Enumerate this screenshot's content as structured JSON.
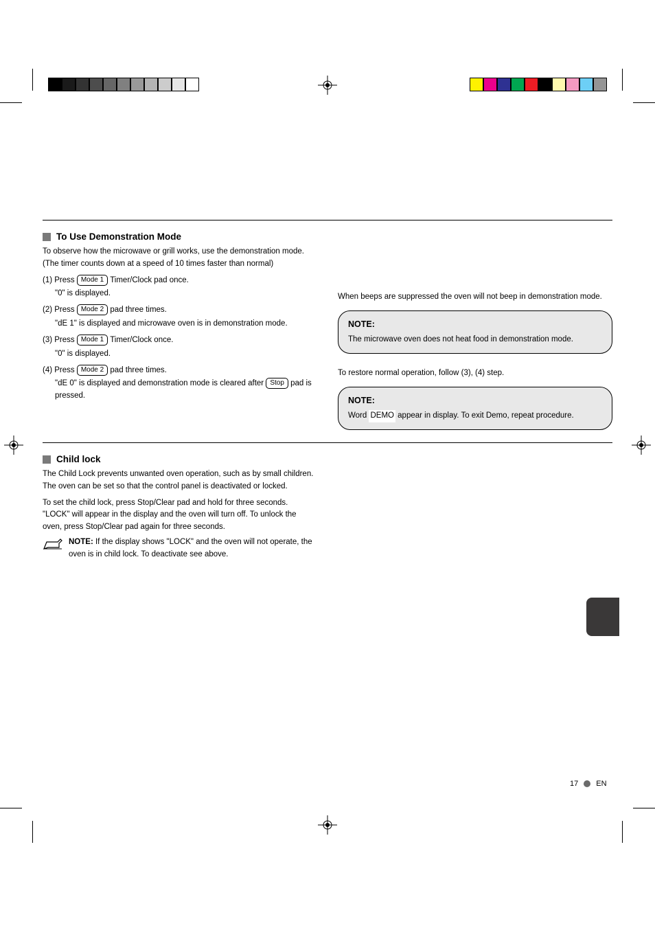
{
  "swatches": {
    "grays": [
      "#000000",
      "#1a1a1a",
      "#333333",
      "#4d4d4d",
      "#666666",
      "#808080",
      "#999999",
      "#b3b3b3",
      "#cccccc",
      "#e5e5e5",
      "#ffffff"
    ],
    "colors": [
      "#fff200",
      "#ec008c",
      "#2e3192",
      "#00a651",
      "#ed1c24",
      "#000000",
      "#fff9ae",
      "#f49ac1",
      "#6dcff6",
      "#959595"
    ]
  },
  "sections": {
    "demo": {
      "title": "To Use Demonstration Mode",
      "left": {
        "l1": "To observe how the microwave or grill works, use the demonstration mode. (The timer counts down at a speed of 10 times faster than normal)",
        "l2a": "(1)  Press ",
        "l2b": "Timer/Clock pad once.",
        "l3a": "\"0\" is displayed.",
        "l4a": "(2) Press ",
        "l4b": "pad three times.",
        "l5a": "\"dE 1\" is displayed and microwave oven is in demonstration mode.",
        "l6a": "(3) Press ",
        "l6b": "Timer/Clock once.",
        "l7a": "\"0\" is displayed.",
        "l8a": "(4) Press ",
        "l8b": "pad three times.",
        "l9a": "\"dE 0\" is displayed and demonstration mode is cleared after ",
        "l9b": "pad is pressed.",
        "key_mode1": "Mode 1",
        "key_mode2": "Mode 2",
        "key_stop": "Stop"
      },
      "right": {
        "p1": "When beeps are suppressed the oven will not beep in demonstration mode.",
        "note1_title": "NOTE:",
        "note1_body": "The microwave oven does not heat food in demonstration mode.",
        "p2": "To restore normal operation, follow (3), (4) step.",
        "note2_title": "NOTE:",
        "note2_body_a": "Word ",
        "note2_body_b": "DEMO",
        "note2_body_c": " appear in display. To exit Demo, repeat procedure."
      }
    },
    "childlock": {
      "title": "Child lock",
      "p1": "The Child Lock prevents unwanted oven operation, such as by small children. The oven can be set so that the control panel is deactivated or locked.",
      "p2": "To set the child lock, press Stop/Clear pad and hold for three seconds. \"LOCK\" will appear in the display and the oven will turn off. To unlock the oven, press Stop/Clear pad again for three seconds.",
      "note": "If the display shows \"LOCK\" and the oven will not operate, the oven is in child lock. To deactivate see above.",
      "note_label": "NOTE:"
    }
  },
  "footer": {
    "page": "17",
    "label_en": "EN"
  }
}
